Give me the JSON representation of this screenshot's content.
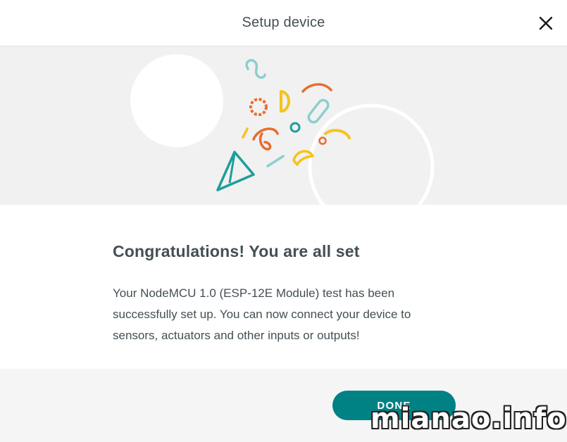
{
  "header": {
    "title": "Setup device",
    "close_icon": "close-icon"
  },
  "hero": {
    "illustration": "confetti-party-popper-icon",
    "colors": {
      "teal": "#1f9e9a",
      "orange": "#e86d2f",
      "yellow": "#f5c31b",
      "light_teal": "#8ccfcc",
      "background": "#f1f1f1"
    }
  },
  "main": {
    "headline": "Congratulations! You are all set",
    "body": "Your NodeMCU 1.0 (ESP-12E Module) test has been successfully set up. You can now connect your device to sensors, actuators and other inputs or outputs!"
  },
  "footer": {
    "done_label": "DONE",
    "accent": "#008184"
  },
  "watermark": {
    "text": "mianao.info"
  }
}
